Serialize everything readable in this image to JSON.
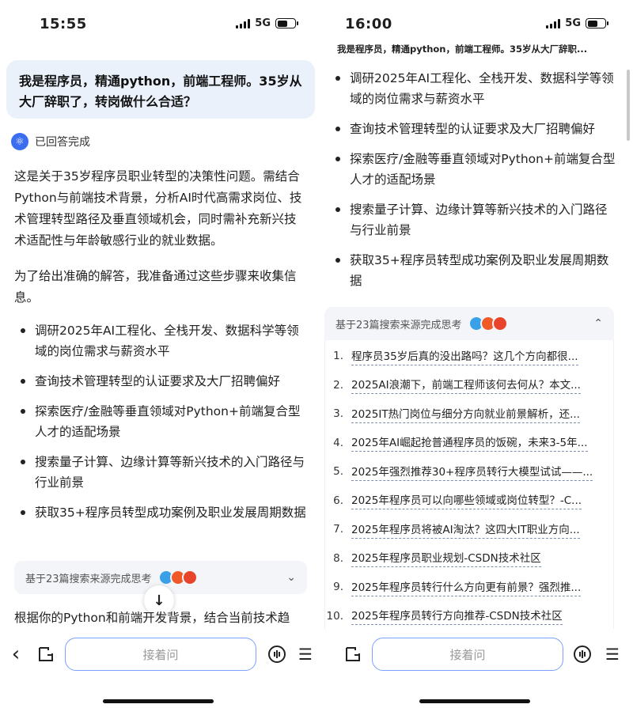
{
  "left": {
    "status": {
      "time": "15:55",
      "network": "5G"
    },
    "question": "我是程序员，精通python，前端工程师。35岁从大厂辞职了，转岗做什么合适？",
    "answered_label": "已回答完成",
    "intro": "这是关于35岁程序员职业转型的决策性问题。需结合Python与前端技术背景，分析AI时代高需求岗位、技术管理转型路径及垂直领域机会，同时需补充新兴技术适配性与年龄敏感行业的就业数据。",
    "steps_intro": "为了给出准确的解答，我准备通过这些步骤来收集信息。",
    "steps": [
      "调研2025年AI工程化、全栈开发、数据科学等领域的岗位需求与薪资水平",
      "查询技术管理转型的认证要求及大厂招聘偏好",
      "探索医疗/金融等垂直领域对Python+前端复合型人才的适配场景",
      "搜索量子计算、边缘计算等新兴技术的入门路径与行业前景",
      "获取35+程序员转型成功案例及职业发展周期数据"
    ],
    "sources_label": "基于23篇搜索来源完成思考",
    "trailing": "根据你的Python和前端开发背景，结合当前技术趋",
    "ask_placeholder": "接着问",
    "down_arrow": "↓"
  },
  "right": {
    "status": {
      "time": "16:00",
      "network": "5G"
    },
    "header_title": "我是程序员，精通python，前端工程师。35岁从大厂辞职...",
    "steps": [
      "调研2025年AI工程化、全栈开发、数据科学等领域的岗位需求与薪资水平",
      "查询技术管理转型的认证要求及大厂招聘偏好",
      "探索医疗/金融等垂直领域对Python+前端复合型人才的适配场景",
      "搜索量子计算、边缘计算等新兴技术的入门路径与行业前景",
      "获取35+程序员转型成功案例及职业发展周期数据"
    ],
    "sources_label": "基于23篇搜索来源完成思考",
    "sources": [
      {
        "n": "1.",
        "title": "程序员35岁后真的没出路吗？这几个方向都很..."
      },
      {
        "n": "2.",
        "title": "2025AI浪潮下，前端工程师该何去何从？本文..."
      },
      {
        "n": "3.",
        "title": "2025IT热门岗位与细分方向就业前景解析，还..."
      },
      {
        "n": "4.",
        "title": "2025年AI崛起抢普通程序员的饭碗，未来3-5年..."
      },
      {
        "n": "5.",
        "title": "2025年强烈推荐30+程序员转行大模型试试——..."
      },
      {
        "n": "6.",
        "title": "2025年程序员可以向哪些领域或岗位转型？-C..."
      },
      {
        "n": "7.",
        "title": "2025年程序员将被AI淘汰？这四大IT职业方向..."
      },
      {
        "n": "8.",
        "title": "2025年程序员职业规划-CSDN技术社区"
      },
      {
        "n": "9.",
        "title": "2025年程序员转行什么方向更有前景？强烈推..."
      },
      {
        "n": "10.",
        "title": "2025年程序员转行方向推荐-CSDN技术社区"
      }
    ],
    "ask_placeholder": "接着问"
  },
  "icons": {
    "back": "‹",
    "new_chat": "new-chat-icon",
    "voice": "voice-icon",
    "menu": "☰",
    "chevron_up": "⌃"
  },
  "colors": {
    "accent": "#3a6df0",
    "question_bg": "#eaf1fb",
    "input_border": "#7ba2ff"
  }
}
